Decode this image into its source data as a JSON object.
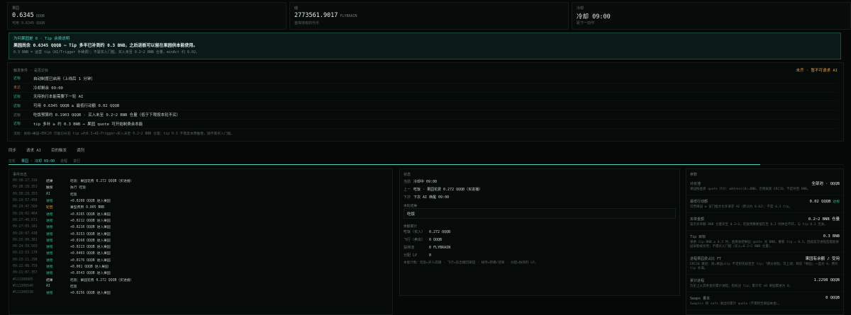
{
  "stats": [
    {
      "label": "果园",
      "value": "0.6345",
      "unit": "QQQB",
      "sub": "可用 0.6345 QQQB"
    },
    {
      "label": "储",
      "value": "2773561.9017",
      "unit": "FLYBRAIN",
      "sub": "金库持有的代币"
    },
    {
      "label": "冷却",
      "value": "冷却 09:00",
      "unit": "",
      "sub": "距下一动作"
    }
  ],
  "banner": {
    "title": "为何果园是 0 · Tip 余费说明",
    "main": "果园尚余 0.6345 QQQB — Tip 多半已补到约 0.3 BNB，之后进板可以留在果园供本能使用。",
    "note": "0.3 BNB = 运营 tip（AI/Trigger 手续费）；不需买入门槛，买入未至 0.2~2 BNB 仓量，minAct 约 0.02。"
  },
  "conditions": {
    "header_left": "触发条件 · 是否达标",
    "header_right": "未齐 · 暂不可请求 AI",
    "rows": [
      {
        "k": "达标",
        "v": "自动制度已启用（上线后 1 分钟）",
        "state": "ok"
      },
      {
        "k": "未达",
        "v": "冷却剩余 09:00",
        "state": "warn"
      },
      {
        "k": "达标",
        "v": "无待执行本能需要下一轮 AI",
        "state": "ok"
      },
      {
        "k": "达标",
        "v": "可用 0.6345 QQQB ≥ 最低行动额 0.02 QQQB",
        "state": "ok"
      },
      {
        "k": "达标",
        "v": "吃饭预算约 0.1903 QQQB · 买入未至 0.2~2 BNB 仓量（低于下限按本轮不买）",
        "state": "muted"
      },
      {
        "k": "达标",
        "v": "tip 多补 ≥ 约 0.3 BNB → 果园 quote 可开始制费余本能",
        "state": "ok"
      }
    ],
    "note": "流程：进程→果园→ERC20 可能已补充 tip ≥约0.3→AI→Trigger→买入未至 0.2~2 BNB 仓量；tip 0.3 不需卖本费推卷，随不需买入门槛。"
  },
  "tabs": [
    "同步",
    "请求 AI",
    "目的触发",
    "调剂"
  ],
  "subtabs": [
    "在轮",
    "果园 · 冷却 09:00",
    "进程",
    "进行"
  ],
  "progress": 0.9,
  "log": {
    "title": "事件日志",
    "rows": [
      {
        "ts": "09:38:27.316",
        "tp": "结果",
        "cls": "decide",
        "msg": "吃饭：果园花费 0.272 QQQB（买进播）"
      },
      {
        "ts": "09:38:28.353",
        "tp": "触发",
        "cls": "decide",
        "msg": "执行 吃饭"
      },
      {
        "ts": "09:38:28.353",
        "tp": "AI",
        "cls": "ai",
        "msg": "吃饭"
      },
      {
        "ts": "09:29:57.456",
        "tp": "进程",
        "cls": "fund",
        "msg": "+0.0208 QQQB 进入果园"
      },
      {
        "ts": "09:29:47.560",
        "tp": "轮回",
        "cls": "swap",
        "msg": "果型费用 0.005 BNB"
      },
      {
        "ts": "09:29:02.464",
        "tp": "进程",
        "cls": "fund",
        "msg": "+0.0265 QQQB 进入果园"
      },
      {
        "ts": "09:27:40.671",
        "tp": "进程",
        "cls": "fund",
        "msg": "+0.0212 QQQB 进入果园"
      },
      {
        "ts": "09:27:03.181",
        "tp": "进程",
        "cls": "fund",
        "msg": "+0.0210 QQQB 进入果园"
      },
      {
        "ts": "09:26:07.438",
        "tp": "进程",
        "cls": "fund",
        "msg": "+0.0253 QQQB 进入果园"
      },
      {
        "ts": "09:25:00.381",
        "tp": "进程",
        "cls": "fund",
        "msg": "+0.0168 QQQB 进入果园"
      },
      {
        "ts": "09:24:59.503",
        "tp": "进程",
        "cls": "fund",
        "msg": "+0.0213 QQQB 进入果园"
      },
      {
        "ts": "09:23:53.170",
        "tp": "进程",
        "cls": "fund",
        "msg": "+0.0403 QQQB 进入果园"
      },
      {
        "ts": "09:23:11.298",
        "tp": "进程",
        "cls": "fund",
        "msg": "+0.0176 QQQB 进入果园"
      },
      {
        "ts": "09:22:08.759",
        "tp": "进程",
        "cls": "fund",
        "msg": "+0.001 QQQB 进入果园"
      },
      {
        "ts": "09:21:07.357",
        "tp": "进程",
        "cls": "fund",
        "msg": "+0.0543 QQQB 进入果园"
      },
      {
        "ts": "#111306005",
        "tp": "结果",
        "cls": "decide",
        "msg": "吃饭：果园花费 0.272 QQQB（买进播）"
      },
      {
        "ts": "#111306540",
        "tp": "AI",
        "cls": "ai",
        "msg": "吃饭"
      },
      {
        "ts": "#111306538",
        "tp": "进程",
        "cls": "fund",
        "msg": "+0.0256 QQQB 进入果园"
      }
    ]
  },
  "status": {
    "title": "状态",
    "rows": [
      {
        "k": "当前",
        "v": "冷却中 09:00"
      },
      {
        "k": "上一",
        "v": "吃饭 · 果园花费 0.272 QQQB（买进播）"
      },
      {
        "k": "下次",
        "v": "下次 AI 唤醒 09:00"
      }
    ],
    "decision_title": "本轮结果",
    "decision": "吃饭",
    "balance_title": "余额累计",
    "balances": [
      {
        "k": "吃饭（买入）",
        "v": "0.272 QQQB"
      },
      {
        "k": "飞行（卖出）",
        "v": "0 QQQB"
      },
      {
        "k": "扶持池",
        "v": "0 FLYBRAIN"
      },
      {
        "k": "分配 LP",
        "v": "0"
      }
    ],
    "note": "本能计数：吃饭=买入成播 · 飞行=卖出播回果园 · 扶持=转播/烧毁 · 分配=扶持的 LP。"
  },
  "params": {
    "title": "参数",
    "items": [
      {
        "name": "计价池",
        "value": "全部池 · QQQB",
        "tag": "",
        "desc": "果园按金库 quote 计价：address(0)=BNB，否则按某 ERC20，不是导回 BNB。"
      },
      {
        "name": "最低行动额",
        "value": "0.02 QQQB",
        "tag": "达标",
        "desc": "可用果园 ≥ 该门槛才允许请求 AI（默认约 0.02）；不是 0.3 tip。"
      },
      {
        "name": "买单金额",
        "value": "0.2~2 BNB 仓量",
        "tag": "",
        "desc": "案示买单额 BNB 仓量买至 0.2~2，吃饭预算要留在至 0.2 时休出不开。与 tip 0.3 无关。"
      },
      {
        "name": "Tip 目标",
        "value": "0.3 BNB",
        "tag": "",
        "desc": "果余 tip BNB ≥ 0.3 时，金库会把果园 quote 兑 BNB，重新 tip = 0.3，因此前方进程后着能果园早能被兑完；不需买入门槛（买入=0.2~2 BNB 仓量）。"
      },
      {
        "name": "进程果园费占比 FT",
        "value": "果园有余额 / 受用",
        "tag": "",
        "desc": "ERC20 路径：则=果园=tip 不足则先续签至 tip；「费分进程」可上调；目前「果园」一直为 0，费托 tip 补满。"
      },
      {
        "name": "累计进程",
        "value": "1.2298 QQQB",
        "tag": "",
        "desc": "历史上从其余金的累计进程，指标注 tip；累计可 nB 果园累进为 0。"
      },
      {
        "name": "Swaps 量本",
        "value": "0 QQQB",
        "tag": "",
        "desc": "Swapsis 和 sufx 进出的累计 quote（不累积至果园本金）。"
      }
    ]
  },
  "colors": {
    "accent": "#4fd1c5",
    "ok": "#3fbf8f",
    "warn": "#e0604a",
    "amber": "#e0a044"
  }
}
